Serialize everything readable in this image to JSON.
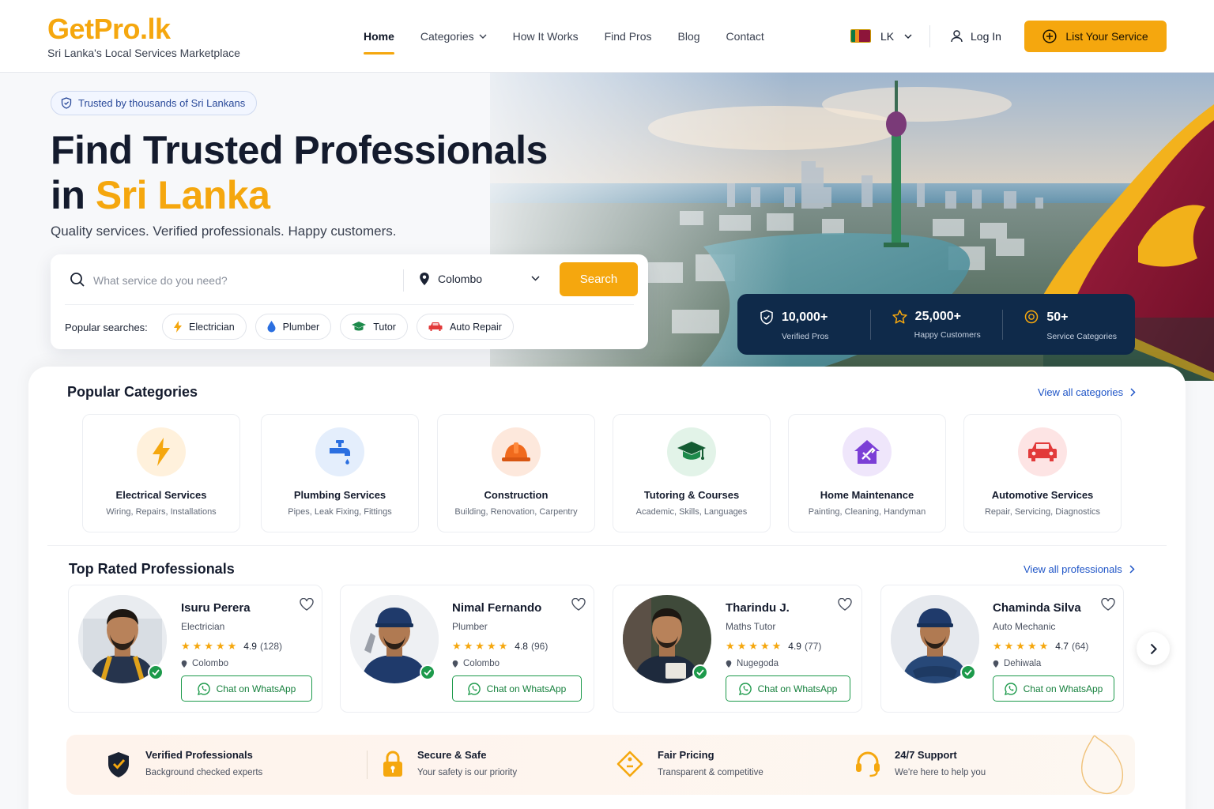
{
  "brand": {
    "logo": "GetPro.lk",
    "tagline": "Sri Lanka's Local Services Marketplace"
  },
  "nav": {
    "items": [
      {
        "label": "Home",
        "active": true
      },
      {
        "label": "Categories",
        "dropdown": true
      },
      {
        "label": "How It Works"
      },
      {
        "label": "Find Pros"
      },
      {
        "label": "Blog"
      },
      {
        "label": "Contact"
      }
    ],
    "language": "LK",
    "login": "Log In",
    "cta": "List Your Service"
  },
  "hero": {
    "badge": "Trusted by thousands of Sri Lankans",
    "title_line1": "Find Trusted Professionals",
    "title_line2_prefix": "in ",
    "title_line2_accent": "Sri Lanka",
    "subtitle": "Quality services. Verified professionals. Happy customers."
  },
  "search": {
    "placeholder": "What service do you need?",
    "location": "Colombo",
    "button": "Search",
    "popular_label": "Popular searches:",
    "popular": [
      {
        "label": "Electrician",
        "icon": "lightning-icon"
      },
      {
        "label": "Plumber",
        "icon": "water-drop-icon"
      },
      {
        "label": "Tutor",
        "icon": "graduation-cap-icon"
      },
      {
        "label": "Auto Repair",
        "icon": "car-icon"
      }
    ]
  },
  "stats": [
    {
      "value": "10,000+",
      "label": "Verified Pros",
      "icon": "shield-check-icon"
    },
    {
      "value": "25,000+",
      "label": "Happy Customers",
      "icon": "star-icon"
    },
    {
      "value": "50+",
      "label": "Service Categories",
      "icon": "badge-icon"
    }
  ],
  "categories": {
    "title": "Popular Categories",
    "view_all": "View all categories",
    "items": [
      {
        "title": "Electrical Services",
        "desc": "Wiring, Repairs, Installations",
        "icon": "lightning-icon",
        "color": "#f5a70e",
        "bg": "#fff1dc"
      },
      {
        "title": "Plumbing Services",
        "desc": "Pipes, Leak Fixing, Fittings",
        "icon": "faucet-icon",
        "color": "#2b6fe0",
        "bg": "#e4eefc"
      },
      {
        "title": "Construction",
        "desc": "Building, Renovation, Carpentry",
        "icon": "hard-hat-icon",
        "color": "#f06a1d",
        "bg": "#fde8dc"
      },
      {
        "title": "Tutoring & Courses",
        "desc": "Academic, Skills, Languages",
        "icon": "graduation-cap-icon",
        "color": "#1d8a4b",
        "bg": "#e2f3e8"
      },
      {
        "title": "Home Maintenance",
        "desc": "Painting, Cleaning, Handyman",
        "icon": "house-tools-icon",
        "color": "#7b3fd6",
        "bg": "#efe6fb"
      },
      {
        "title": "Automotive Services",
        "desc": "Repair, Servicing, Diagnostics",
        "icon": "car-icon",
        "color": "#e23a3a",
        "bg": "#fde4e4"
      }
    ]
  },
  "professionals": {
    "title": "Top Rated Professionals",
    "view_all": "View all professionals",
    "items": [
      {
        "name": "Isuru Perera",
        "role": "Electrician",
        "rating": "4.9",
        "reviews": "(128)",
        "location": "Colombo",
        "action": "Chat on WhatsApp"
      },
      {
        "name": "Nimal Fernando",
        "role": "Plumber",
        "rating": "4.8",
        "reviews": "(96)",
        "location": "Colombo",
        "action": "Chat on WhatsApp"
      },
      {
        "name": "Tharindu J.",
        "role": "Maths Tutor",
        "rating": "4.9",
        "reviews": "(77)",
        "location": "Nugegoda",
        "action": "Chat on WhatsApp"
      },
      {
        "name": "Chaminda Silva",
        "role": "Auto Mechanic",
        "rating": "4.7",
        "reviews": "(64)",
        "location": "Dehiwala",
        "action": "Chat on WhatsApp"
      }
    ]
  },
  "features": [
    {
      "title": "Verified Professionals",
      "desc": "Background checked experts",
      "icon": "shield-check-icon"
    },
    {
      "title": "Secure & Safe",
      "desc": "Your safety is our priority",
      "icon": "lock-icon"
    },
    {
      "title": "Fair Pricing",
      "desc": "Transparent & competitive",
      "icon": "price-tag-icon"
    },
    {
      "title": "24/7 Support",
      "desc": "We're here to help you",
      "icon": "headset-icon"
    }
  ],
  "colors": {
    "accent": "#f5a70e",
    "navy": "#0f2a4a",
    "link": "#1f55c7",
    "whatsapp": "#1d9a4b"
  }
}
